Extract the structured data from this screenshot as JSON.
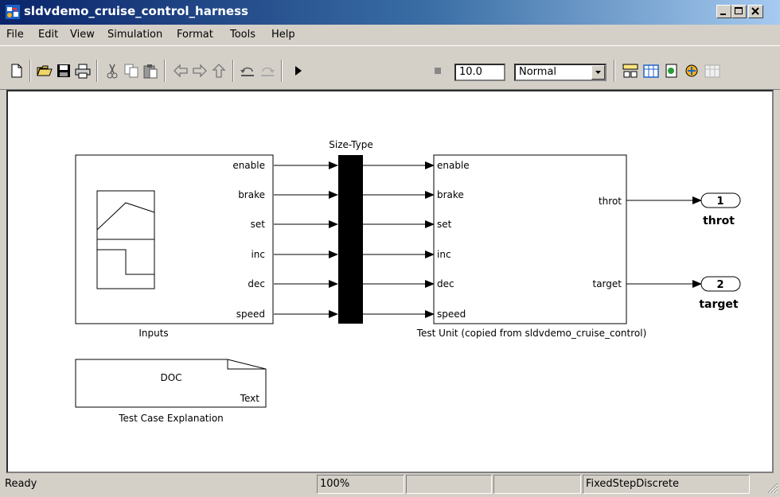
{
  "window": {
    "title": "sldvdemo_cruise_control_harness"
  },
  "menu": [
    "File",
    "Edit",
    "View",
    "Simulation",
    "Format",
    "Tools",
    "Help"
  ],
  "toolbar": {
    "stop_time": "10.0",
    "sim_mode": "Normal"
  },
  "diagram": {
    "inputs_block": {
      "label": "Inputs",
      "ports": [
        "enable",
        "brake",
        "set",
        "inc",
        "dec",
        "speed"
      ]
    },
    "size_type_label": "Size-Type",
    "test_unit": {
      "label": "Test Unit (copied from sldvdemo_cruise_control)",
      "in_ports": [
        "enable",
        "brake",
        "set",
        "inc",
        "dec",
        "speed"
      ],
      "out_ports": [
        "throt",
        "target"
      ]
    },
    "outports": [
      {
        "number": "1",
        "name": "throt"
      },
      {
        "number": "2",
        "name": "target"
      }
    ],
    "doc_block": {
      "title": "DOC",
      "subtitle": "Text",
      "label": "Test Case Explanation"
    }
  },
  "status": {
    "state": "Ready",
    "zoom": "100%",
    "solver": "FixedStepDiscrete"
  },
  "colors": {
    "titlebar_start": "#0a246a",
    "titlebar_end": "#a6caf0",
    "chrome": "#d4d0c8"
  }
}
